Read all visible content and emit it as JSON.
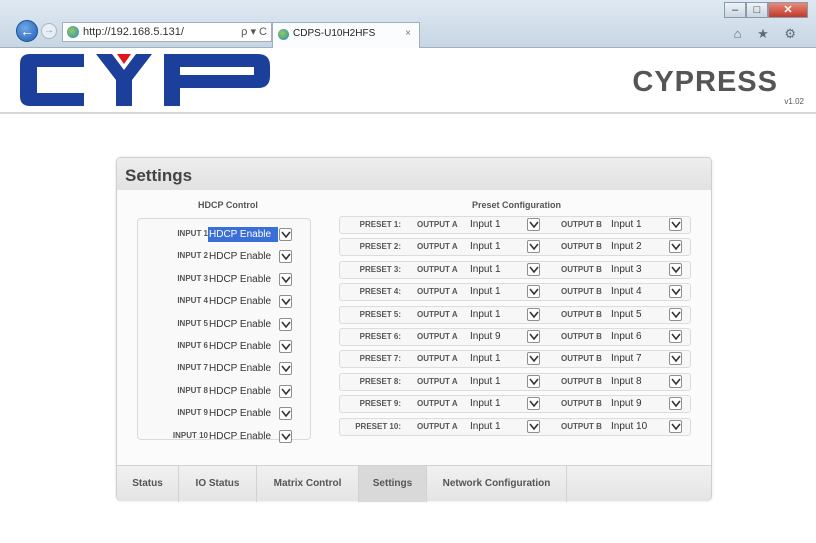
{
  "browser": {
    "url": "http://192.168.5.131/",
    "address_controls": "ρ ▾ C",
    "tab_title": "CDPS-U10H2HFS",
    "tab_close": "×",
    "window_buttons": {
      "minimize": "–",
      "maximize": "□",
      "close": "✕"
    },
    "toolbar_icons": "⌂ ★ ⚙"
  },
  "header": {
    "brand": "CYPRESS",
    "version": "v1.02",
    "logo_colors": {
      "blue": "#1b3f9b",
      "red": "#e3141c"
    }
  },
  "settings": {
    "title": "Settings",
    "hdcp_title": "HDCP Control",
    "preset_title": "Preset Configuration",
    "hdcp_rows": [
      {
        "label": "INPUT 1",
        "value": "HDCP Enable",
        "selected": true
      },
      {
        "label": "INPUT 2",
        "value": "HDCP Enable"
      },
      {
        "label": "INPUT 3",
        "value": "HDCP Enable"
      },
      {
        "label": "INPUT 4",
        "value": "HDCP Enable"
      },
      {
        "label": "INPUT 5",
        "value": "HDCP Enable"
      },
      {
        "label": "INPUT 6",
        "value": "HDCP Enable"
      },
      {
        "label": "INPUT 7",
        "value": "HDCP Enable"
      },
      {
        "label": "INPUT 8",
        "value": "HDCP Enable"
      },
      {
        "label": "INPUT 9",
        "value": "HDCP Enable"
      },
      {
        "label": "INPUT 10",
        "value": "HDCP Enable"
      }
    ],
    "presets": [
      {
        "label": "PRESET 1:",
        "output_a_label": "OUTPUT A",
        "output_a": "Input 1",
        "output_b_label": "OUTPUT B",
        "output_b": "Input 1"
      },
      {
        "label": "PRESET 2:",
        "output_a_label": "OUTPUT A",
        "output_a": "Input 1",
        "output_b_label": "OUTPUT B",
        "output_b": "Input 2"
      },
      {
        "label": "PRESET 3:",
        "output_a_label": "OUTPUT A",
        "output_a": "Input 1",
        "output_b_label": "OUTPUT B",
        "output_b": "Input 3"
      },
      {
        "label": "PRESET 4:",
        "output_a_label": "OUTPUT A",
        "output_a": "Input 1",
        "output_b_label": "OUTPUT B",
        "output_b": "Input 4"
      },
      {
        "label": "PRESET 5:",
        "output_a_label": "OUTPUT A",
        "output_a": "Input 1",
        "output_b_label": "OUTPUT B",
        "output_b": "Input 5"
      },
      {
        "label": "PRESET 6:",
        "output_a_label": "OUTPUT A",
        "output_a": "Input 9",
        "output_b_label": "OUTPUT B",
        "output_b": "Input 6"
      },
      {
        "label": "PRESET 7:",
        "output_a_label": "OUTPUT A",
        "output_a": "Input 1",
        "output_b_label": "OUTPUT B",
        "output_b": "Input 7"
      },
      {
        "label": "PRESET 8:",
        "output_a_label": "OUTPUT A",
        "output_a": "Input 1",
        "output_b_label": "OUTPUT B",
        "output_b": "Input 8"
      },
      {
        "label": "PRESET 9:",
        "output_a_label": "OUTPUT A",
        "output_a": "Input 1",
        "output_b_label": "OUTPUT B",
        "output_b": "Input 9"
      },
      {
        "label": "PRESET 10:",
        "output_a_label": "OUTPUT A",
        "output_a": "Input 1",
        "output_b_label": "OUTPUT B",
        "output_b": "Input 10"
      }
    ],
    "tabs": [
      {
        "label": "Status"
      },
      {
        "label": "IO Status"
      },
      {
        "label": "Matrix Control"
      },
      {
        "label": "Settings",
        "active": true
      },
      {
        "label": "Network Configuration"
      }
    ]
  }
}
